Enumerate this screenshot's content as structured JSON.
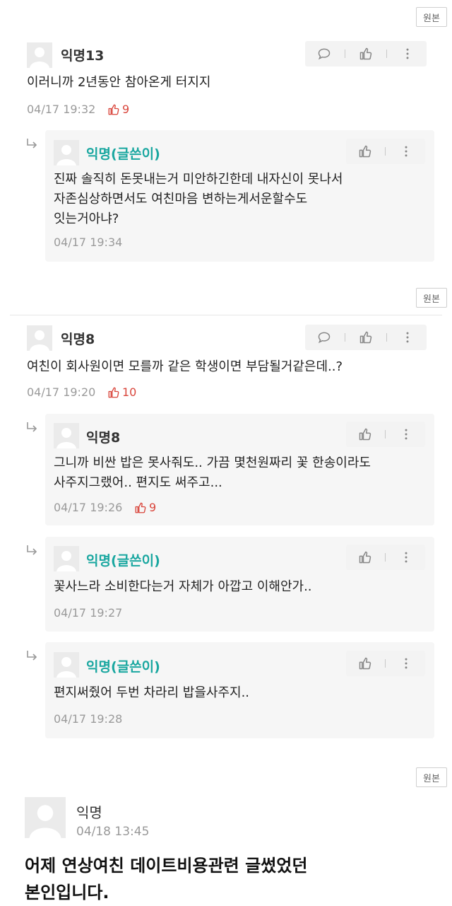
{
  "orig_label": "원본",
  "threads": [
    {
      "comment": {
        "author": "익명13",
        "text": [
          "이러니까 2년동안 참아온게 터지지"
        ],
        "time": "04/17 19:32",
        "likes": "9"
      },
      "replies": [
        {
          "author": "익명(글쓴이)",
          "text": [
            "진짜 솔직히 돈못내는거 미안하긴한데 내자신이 못나서",
            "자존심상하면서도 여친마음 변하는게서운할수도",
            "잇는거아냐?"
          ],
          "time": "04/17 19:34",
          "likes": ""
        }
      ]
    },
    {
      "comment": {
        "author": "익명8",
        "text": [
          "여친이 회사원이면 모를까 같은 학생이면 부담될거같은데..?"
        ],
        "time": "04/17 19:20",
        "likes": "10"
      },
      "replies": [
        {
          "author": "익명8",
          "text": [
            "그니까 비싼 밥은 못사줘도.. 가끔 몇천원짜리 꽃 한송이라도",
            "사주지그랬어.. 편지도 써주고..."
          ],
          "time": "04/17 19:26",
          "likes": "9"
        },
        {
          "author": "익명(글쓴이)",
          "text": [
            "꽃사느라 소비한다는거 자체가 아깝고 이해안가.."
          ],
          "time": "04/17 19:27",
          "likes": ""
        },
        {
          "author": "익명(글쓴이)",
          "text": [
            "편지써줬어 두번 차라리 밥을사주지.."
          ],
          "time": "04/17 19:28",
          "likes": ""
        }
      ]
    }
  ],
  "post": {
    "author": "익명",
    "time": "04/18 13:45",
    "text": [
      "어제 연상여친 데이트비용관련 글썼었던",
      "본인입니다."
    ]
  },
  "colors": {
    "author_accent": "#1aa7a0",
    "like_red": "#d9453b"
  }
}
